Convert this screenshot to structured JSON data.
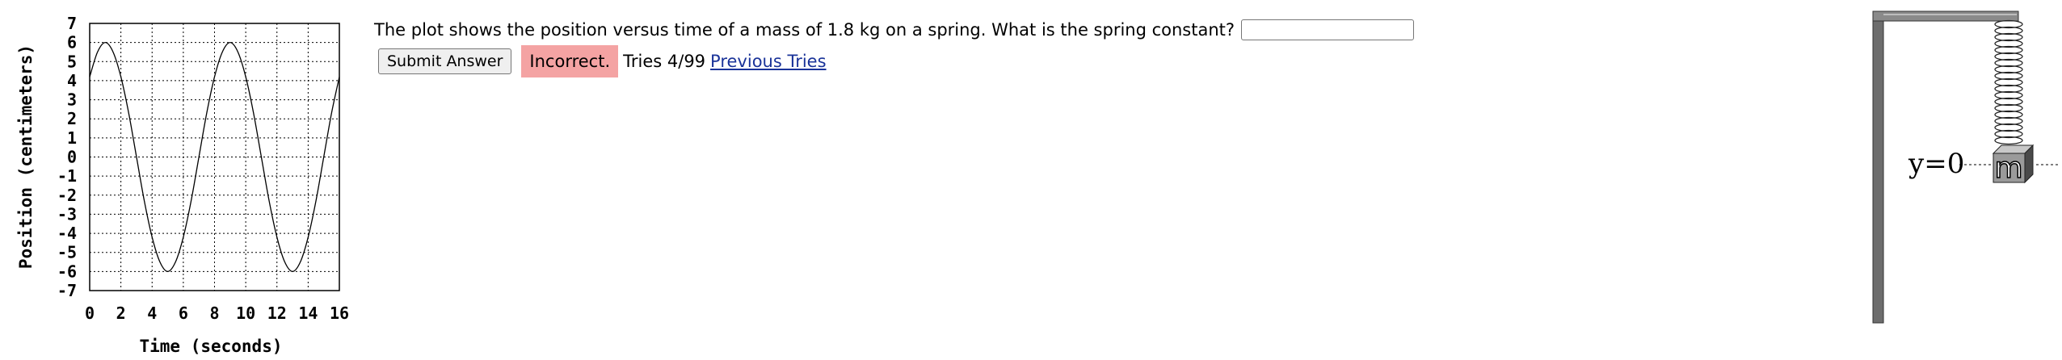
{
  "chart_data": {
    "type": "line",
    "xlabel": "Time (seconds)",
    "ylabel": "Position (centimeters)",
    "xlim": [
      0,
      16
    ],
    "ylim": [
      -7,
      7
    ],
    "x_ticks": [
      "0",
      "2",
      "4",
      "6",
      "8",
      "10",
      "12",
      "14",
      "16"
    ],
    "y_ticks": [
      "7",
      "6",
      "5",
      "4",
      "3",
      "2",
      "1",
      "0",
      "-1",
      "-2",
      "-3",
      "-4",
      "-5",
      "-6",
      "-7"
    ],
    "grid": true,
    "series": [
      {
        "x": [
          0,
          0.5,
          1,
          1.5,
          2,
          2.5,
          3,
          3.5,
          4,
          4.5,
          5,
          5.5,
          6,
          6.5,
          7,
          7.5,
          8,
          8.5,
          9,
          9.5,
          10,
          10.5,
          11,
          11.5,
          12,
          12.5,
          13,
          13.5,
          14,
          14.5,
          15,
          15.5,
          16
        ],
        "values": [
          4.2,
          5.5,
          6,
          5.5,
          4.2,
          2.3,
          0,
          -2.3,
          -4.2,
          -5.5,
          -6,
          -5.5,
          -4.2,
          -2.3,
          0,
          2.3,
          4.2,
          5.5,
          6,
          5.5,
          4.2,
          2.3,
          0,
          -2.3,
          -4.2,
          -5.5,
          -6,
          -5.5,
          -4.2,
          -2.3,
          0,
          2.3,
          4.2
        ]
      }
    ]
  },
  "question": {
    "text": "The plot shows the position versus time of a mass of 1.8 kg on a spring. What is the spring constant?",
    "answer_value": ""
  },
  "controls": {
    "submit_label": "Submit Answer",
    "status": "Incorrect.",
    "tries": "Tries 4/99",
    "previous_tries": "Previous Tries"
  },
  "diagram": {
    "y_label": "y=0",
    "mass_label": "m"
  }
}
